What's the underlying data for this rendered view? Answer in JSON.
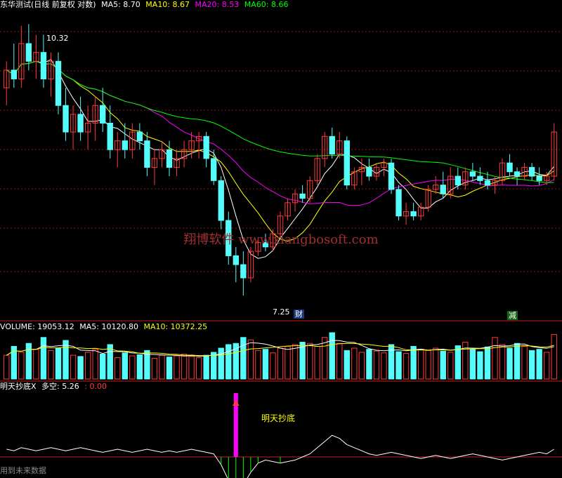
{
  "main_panel": {
    "title": "东华测试(日线 前复权 对数)",
    "indicators": [
      {
        "label": "MA5: 8.70",
        "color": "#ffffff"
      },
      {
        "label": "MA10: 8.67",
        "color": "#ffff00"
      },
      {
        "label": "MA20: 8.53",
        "color": "#ff00ff"
      },
      {
        "label": "MA60: 8.66",
        "color": "#00ff00"
      }
    ],
    "high_label": "10.32",
    "low_label": "7.25",
    "badge_left": "财",
    "badge_right": "减",
    "watermark": "翔博软件 www.xiangbosoft.com"
  },
  "volume_panel": {
    "indicators": [
      {
        "label": "VOLUME: 19053.12",
        "color": "#ffffff"
      },
      {
        "label": "MA5: 10120.80",
        "color": "#ffffff"
      },
      {
        "label": "MA10: 10372.25",
        "color": "#ffff00"
      }
    ]
  },
  "signal_panel": {
    "title": "明天抄底X",
    "value_label": "多空: 5.26",
    "value2_label": ": 0.00",
    "signal_text": "明天抄底",
    "footer_text": "用到未来数据"
  },
  "colors": {
    "up": "#ff3b3b",
    "down": "#54fcfc",
    "ma5": "#ffffff",
    "ma10": "#ffff00",
    "ma20": "#ff00ff",
    "ma60": "#00ff00",
    "grid": "#8b1a1a",
    "divider": "#c81e1e"
  },
  "chart_data": {
    "type": "candlestick",
    "price_range": [
      7.25,
      10.32
    ],
    "candles": [
      {
        "o": 9.6,
        "h": 9.9,
        "l": 9.4,
        "c": 9.8
      },
      {
        "o": 9.8,
        "h": 10.1,
        "l": 9.6,
        "c": 9.7
      },
      {
        "o": 9.7,
        "h": 10.3,
        "l": 9.6,
        "c": 10.1
      },
      {
        "o": 10.1,
        "h": 10.32,
        "l": 9.8,
        "c": 9.9
      },
      {
        "o": 9.9,
        "h": 10.2,
        "l": 9.7,
        "c": 10.0
      },
      {
        "o": 10.0,
        "h": 10.2,
        "l": 9.6,
        "c": 9.7
      },
      {
        "o": 9.7,
        "h": 10.0,
        "l": 9.5,
        "c": 9.9
      },
      {
        "o": 9.9,
        "h": 10.0,
        "l": 9.3,
        "c": 9.4
      },
      {
        "o": 9.4,
        "h": 9.6,
        "l": 9.0,
        "c": 9.1
      },
      {
        "o": 9.1,
        "h": 9.4,
        "l": 8.9,
        "c": 9.3
      },
      {
        "o": 9.3,
        "h": 9.5,
        "l": 9.0,
        "c": 9.1
      },
      {
        "o": 9.1,
        "h": 9.4,
        "l": 8.9,
        "c": 9.2
      },
      {
        "o": 9.2,
        "h": 9.5,
        "l": 9.0,
        "c": 9.4
      },
      {
        "o": 9.4,
        "h": 9.6,
        "l": 9.1,
        "c": 9.2
      },
      {
        "o": 9.2,
        "h": 9.4,
        "l": 8.8,
        "c": 8.9
      },
      {
        "o": 8.9,
        "h": 9.1,
        "l": 8.7,
        "c": 9.0
      },
      {
        "o": 9.0,
        "h": 9.2,
        "l": 8.8,
        "c": 8.9
      },
      {
        "o": 8.9,
        "h": 9.2,
        "l": 8.8,
        "c": 9.1
      },
      {
        "o": 9.1,
        "h": 9.2,
        "l": 8.9,
        "c": 9.0
      },
      {
        "o": 9.0,
        "h": 9.1,
        "l": 8.6,
        "c": 8.7
      },
      {
        "o": 8.7,
        "h": 8.9,
        "l": 8.5,
        "c": 8.8
      },
      {
        "o": 8.8,
        "h": 9.0,
        "l": 8.7,
        "c": 8.9
      },
      {
        "o": 8.9,
        "h": 9.0,
        "l": 8.6,
        "c": 8.7
      },
      {
        "o": 8.7,
        "h": 8.9,
        "l": 8.6,
        "c": 8.8
      },
      {
        "o": 8.8,
        "h": 9.0,
        "l": 8.7,
        "c": 8.9
      },
      {
        "o": 8.9,
        "h": 9.1,
        "l": 8.8,
        "c": 9.0
      },
      {
        "o": 9.0,
        "h": 9.1,
        "l": 8.8,
        "c": 9.05
      },
      {
        "o": 9.05,
        "h": 9.1,
        "l": 8.7,
        "c": 8.8
      },
      {
        "o": 8.8,
        "h": 8.9,
        "l": 8.5,
        "c": 8.55
      },
      {
        "o": 8.55,
        "h": 8.6,
        "l": 8.0,
        "c": 8.1
      },
      {
        "o": 8.1,
        "h": 8.2,
        "l": 7.6,
        "c": 7.7
      },
      {
        "o": 7.7,
        "h": 7.8,
        "l": 7.4,
        "c": 7.6
      },
      {
        "o": 7.6,
        "h": 7.75,
        "l": 7.25,
        "c": 7.45
      },
      {
        "o": 7.45,
        "h": 7.8,
        "l": 7.4,
        "c": 7.75
      },
      {
        "o": 7.75,
        "h": 7.9,
        "l": 7.7,
        "c": 7.85
      },
      {
        "o": 7.85,
        "h": 7.95,
        "l": 7.75,
        "c": 7.8
      },
      {
        "o": 7.8,
        "h": 8.0,
        "l": 7.75,
        "c": 7.95
      },
      {
        "o": 7.95,
        "h": 8.2,
        "l": 7.9,
        "c": 8.15
      },
      {
        "o": 8.15,
        "h": 8.35,
        "l": 8.1,
        "c": 8.3
      },
      {
        "o": 8.3,
        "h": 8.45,
        "l": 8.2,
        "c": 8.4
      },
      {
        "o": 8.4,
        "h": 8.5,
        "l": 8.3,
        "c": 8.35
      },
      {
        "o": 8.35,
        "h": 8.6,
        "l": 8.3,
        "c": 8.55
      },
      {
        "o": 8.55,
        "h": 8.85,
        "l": 8.5,
        "c": 8.8
      },
      {
        "o": 8.8,
        "h": 9.1,
        "l": 8.7,
        "c": 9.05
      },
      {
        "o": 9.05,
        "h": 9.15,
        "l": 8.8,
        "c": 8.85
      },
      {
        "o": 8.85,
        "h": 9.1,
        "l": 8.8,
        "c": 9.0
      },
      {
        "o": 9.0,
        "h": 9.05,
        "l": 8.45,
        "c": 8.5
      },
      {
        "o": 8.5,
        "h": 8.7,
        "l": 8.45,
        "c": 8.65
      },
      {
        "o": 8.65,
        "h": 8.8,
        "l": 8.5,
        "c": 8.7
      },
      {
        "o": 8.7,
        "h": 8.8,
        "l": 8.55,
        "c": 8.6
      },
      {
        "o": 8.6,
        "h": 8.75,
        "l": 8.55,
        "c": 8.7
      },
      {
        "o": 8.7,
        "h": 8.8,
        "l": 8.6,
        "c": 8.75
      },
      {
        "o": 8.75,
        "h": 8.8,
        "l": 8.4,
        "c": 8.45
      },
      {
        "o": 8.45,
        "h": 8.5,
        "l": 8.1,
        "c": 8.15
      },
      {
        "o": 8.15,
        "h": 8.3,
        "l": 8.05,
        "c": 8.2
      },
      {
        "o": 8.2,
        "h": 8.3,
        "l": 8.1,
        "c": 8.15
      },
      {
        "o": 8.15,
        "h": 8.3,
        "l": 8.1,
        "c": 8.25
      },
      {
        "o": 8.25,
        "h": 8.5,
        "l": 8.2,
        "c": 8.45
      },
      {
        "o": 8.45,
        "h": 8.6,
        "l": 8.4,
        "c": 8.5
      },
      {
        "o": 8.5,
        "h": 8.65,
        "l": 8.35,
        "c": 8.4
      },
      {
        "o": 8.4,
        "h": 8.7,
        "l": 8.35,
        "c": 8.6
      },
      {
        "o": 8.6,
        "h": 8.7,
        "l": 8.45,
        "c": 8.5
      },
      {
        "o": 8.5,
        "h": 8.7,
        "l": 8.45,
        "c": 8.65
      },
      {
        "o": 8.65,
        "h": 8.75,
        "l": 8.55,
        "c": 8.6
      },
      {
        "o": 8.6,
        "h": 8.7,
        "l": 8.5,
        "c": 8.55
      },
      {
        "o": 8.55,
        "h": 8.65,
        "l": 8.45,
        "c": 8.5
      },
      {
        "o": 8.5,
        "h": 8.6,
        "l": 8.4,
        "c": 8.55
      },
      {
        "o": 8.55,
        "h": 8.8,
        "l": 8.5,
        "c": 8.75
      },
      {
        "o": 8.75,
        "h": 8.85,
        "l": 8.6,
        "c": 8.65
      },
      {
        "o": 8.65,
        "h": 8.7,
        "l": 8.5,
        "c": 8.6
      },
      {
        "o": 8.6,
        "h": 8.75,
        "l": 8.55,
        "c": 8.7
      },
      {
        "o": 8.7,
        "h": 8.75,
        "l": 8.55,
        "c": 8.6
      },
      {
        "o": 8.6,
        "h": 8.7,
        "l": 8.5,
        "c": 8.55
      },
      {
        "o": 8.55,
        "h": 8.65,
        "l": 8.5,
        "c": 8.6
      },
      {
        "o": 8.6,
        "h": 9.2,
        "l": 8.55,
        "c": 9.1
      }
    ],
    "volumes": [
      40,
      55,
      45,
      60,
      50,
      70,
      48,
      52,
      65,
      40,
      38,
      45,
      50,
      42,
      58,
      36,
      44,
      39,
      41,
      48,
      35,
      40,
      37,
      39,
      42,
      38,
      36,
      40,
      45,
      52,
      58,
      60,
      70,
      66,
      48,
      50,
      44,
      52,
      55,
      58,
      62,
      60,
      55,
      70,
      78,
      60,
      48,
      52,
      45,
      50,
      47,
      44,
      58,
      46,
      43,
      55,
      50,
      48,
      52,
      47,
      45,
      56,
      62,
      50,
      46,
      54,
      70,
      58,
      52,
      60,
      55,
      48,
      50,
      45,
      75
    ],
    "signal_line": [
      5,
      4,
      6,
      5,
      4,
      5,
      6,
      5,
      4,
      5,
      6,
      5,
      4,
      3,
      4,
      5,
      4,
      3,
      4,
      5,
      4,
      3,
      4,
      3,
      4,
      5,
      4,
      3,
      2,
      -5,
      -15,
      -22,
      -18,
      -10,
      -4,
      -2,
      -3,
      -4,
      -3,
      -2,
      0,
      2,
      6,
      10,
      14,
      12,
      8,
      6,
      4,
      2,
      1,
      2,
      3,
      2,
      1,
      0,
      -1,
      0,
      1,
      0,
      -1,
      0,
      1,
      2,
      1,
      0,
      -1,
      -2,
      -1,
      0,
      1,
      2,
      3,
      2,
      5
    ]
  }
}
